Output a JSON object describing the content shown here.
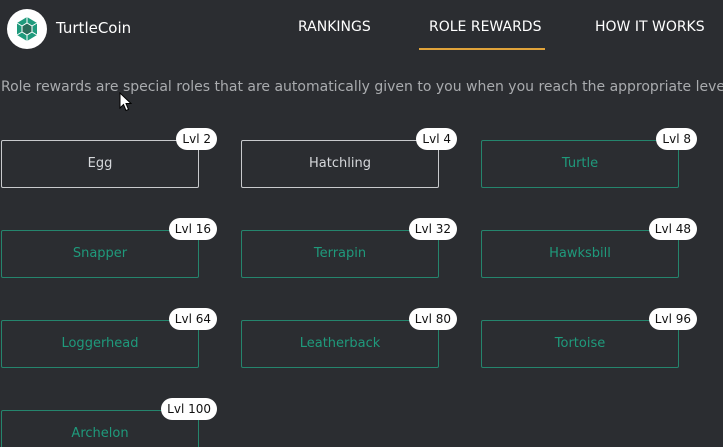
{
  "brand": {
    "name": "TurtleCoin",
    "logo_icon": "turtle-shell-icon"
  },
  "nav": {
    "items": [
      {
        "label": "RANKINGS",
        "active": false
      },
      {
        "label": "ROLE REWARDS",
        "active": true
      },
      {
        "label": "HOW IT WORKS",
        "active": false
      }
    ]
  },
  "intro": "Role rewards are special roles that are automatically given to you when you reach the appropriate level!",
  "roles": [
    {
      "name": "Egg",
      "level": "Lvl 2",
      "unlocked": true
    },
    {
      "name": "Hatchling",
      "level": "Lvl 4",
      "unlocked": true
    },
    {
      "name": "Turtle",
      "level": "Lvl 8",
      "unlocked": false
    },
    {
      "name": "Snapper",
      "level": "Lvl 16",
      "unlocked": false
    },
    {
      "name": "Terrapin",
      "level": "Lvl 32",
      "unlocked": false
    },
    {
      "name": "Hawksbill",
      "level": "Lvl 48",
      "unlocked": false
    },
    {
      "name": "Loggerhead",
      "level": "Lvl 64",
      "unlocked": false
    },
    {
      "name": "Leatherback",
      "level": "Lvl 80",
      "unlocked": false
    },
    {
      "name": "Tortoise",
      "level": "Lvl 96",
      "unlocked": false
    },
    {
      "name": "Archelon",
      "level": "Lvl 100",
      "unlocked": false
    }
  ],
  "colors": {
    "background": "#2b2d31",
    "accent_green": "#1f9a7c",
    "active_tab_underline": "#e0a33a"
  }
}
